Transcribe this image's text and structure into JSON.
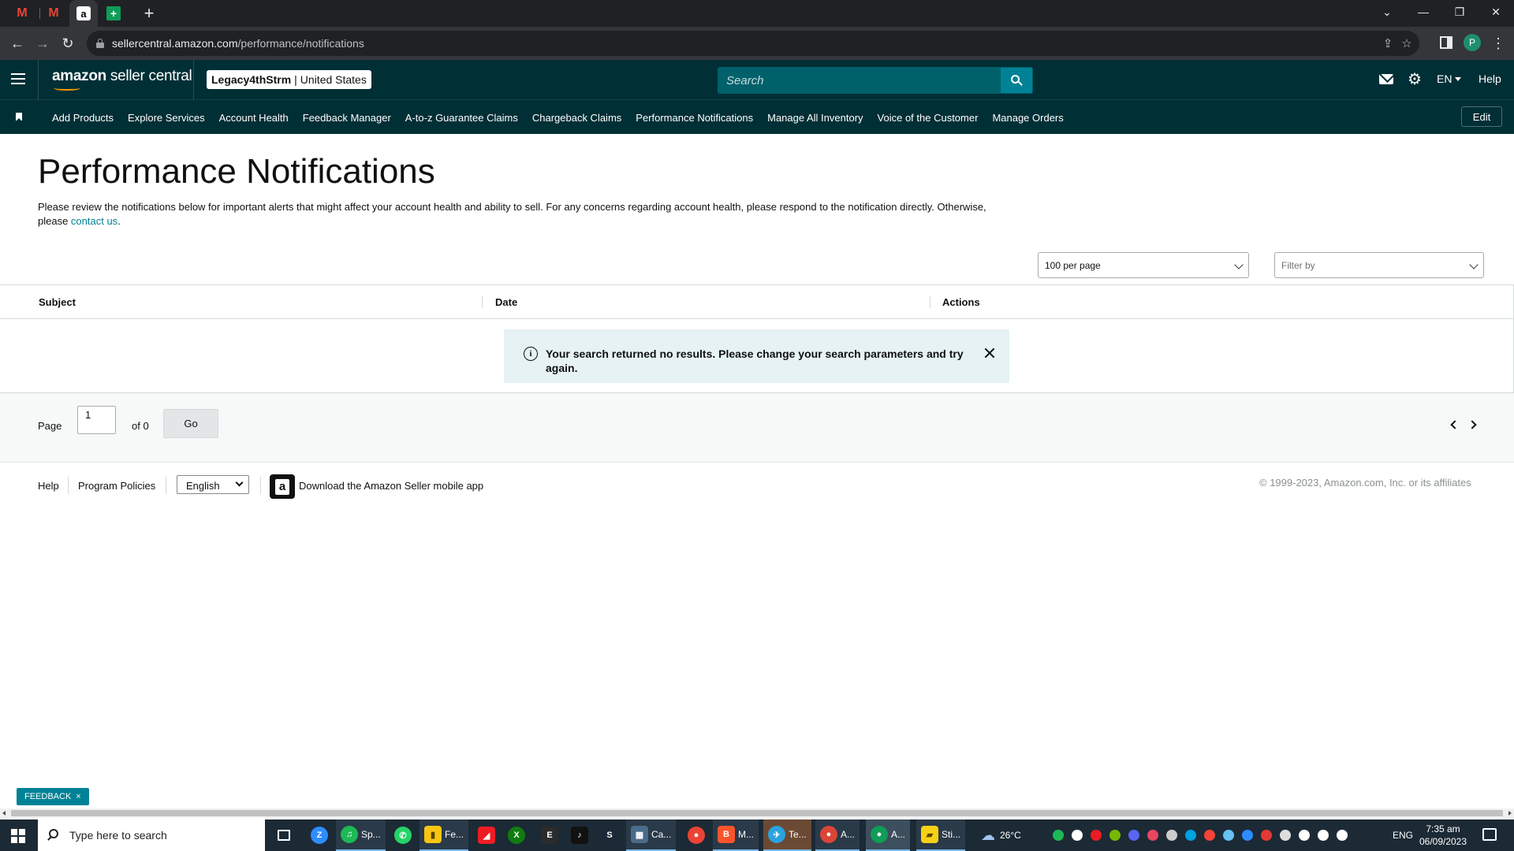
{
  "browser": {
    "url_host": "sellercentral.amazon.com",
    "url_path": "/performance/notifications",
    "profile_initial": "P",
    "tabs": [
      {
        "icon": "gmail-icon",
        "glyph": "M"
      },
      {
        "icon": "gmail-icon",
        "glyph": "M"
      },
      {
        "icon": "amazon-icon",
        "glyph": "a"
      },
      {
        "icon": "sheets-icon",
        "glyph": "+"
      }
    ]
  },
  "header": {
    "logo_text": "amazon",
    "logo_suffix": " seller central",
    "store_name": "Legacy4thStrm",
    "marketplace": "United States",
    "search_placeholder": "Search",
    "language": "EN",
    "help_label": "Help"
  },
  "bookmarks": {
    "items": [
      "Add Products",
      "Explore Services",
      "Account Health",
      "Feedback Manager",
      "A-to-z Guarantee Claims",
      "Chargeback Claims",
      "Performance Notifications",
      "Manage All Inventory",
      "Voice of the Customer",
      "Manage Orders"
    ],
    "edit_label": "Edit"
  },
  "main": {
    "title": "Performance Notifications",
    "intro_text": "Please review the notifications below for important alerts that might affect your account health and ability to sell. For any concerns regarding account health, please respond to the notification directly. Otherwise, please ",
    "contact_link": "contact us",
    "intro_end": ".",
    "per_page": "100 per page",
    "filter_placeholder": "Filter by",
    "table": {
      "columns": [
        "Subject",
        "Date",
        "Actions"
      ]
    },
    "alert_message": "Your search returned no results. Please change your search parameters and try again.",
    "pager": {
      "page_label": "Page",
      "page_value": "1",
      "of_label": "of 0",
      "go_label": "Go"
    }
  },
  "footer": {
    "help": "Help",
    "program_policies": "Program Policies",
    "language": "English",
    "app_download": "Download the Amazon Seller mobile app",
    "copyright": "© 1999-2023, Amazon.com, Inc. or its affiliates"
  },
  "feedback_tab": {
    "label": "FEEDBACK",
    "close": "×"
  },
  "taskbar": {
    "search_placeholder": "Type here to search",
    "apps": [
      {
        "label": "",
        "color": "#2d8cff",
        "glyph": "Z"
      },
      {
        "label": "Sp...",
        "color": "#1db954",
        "glyph": "♫"
      },
      {
        "label": "",
        "color": "#25d366",
        "glyph": "✆"
      },
      {
        "label": "Fe...",
        "color": "#f9c513",
        "glyph": "▮"
      },
      {
        "label": "",
        "color": "#ed1c24",
        "glyph": "◢"
      },
      {
        "label": "",
        "color": "#107c10",
        "glyph": "X"
      },
      {
        "label": "",
        "color": "#2b2b2b",
        "glyph": "E"
      },
      {
        "label": "",
        "color": "#111111",
        "glyph": "♪"
      },
      {
        "label": "",
        "color": "#1b2838",
        "glyph": "S"
      },
      {
        "label": "Ca...",
        "color": "#4a6b8a",
        "glyph": "▦"
      },
      {
        "label": "",
        "color": "#ea4335",
        "glyph": "●"
      },
      {
        "label": "M...",
        "color": "#fb542b",
        "glyph": "B"
      },
      {
        "label": "Te...",
        "color": "#2aa3df",
        "glyph": "✈"
      },
      {
        "label": "A...",
        "color": "#db4437",
        "glyph": "●"
      },
      {
        "label": "A...",
        "color": "#0f9d58",
        "glyph": "●"
      },
      {
        "label": "Sti...",
        "color": "#f7d117",
        "glyph": "▰"
      }
    ],
    "weather": "26°C",
    "language": "ENG",
    "time": "7:35 am",
    "date": "06/09/2023"
  }
}
